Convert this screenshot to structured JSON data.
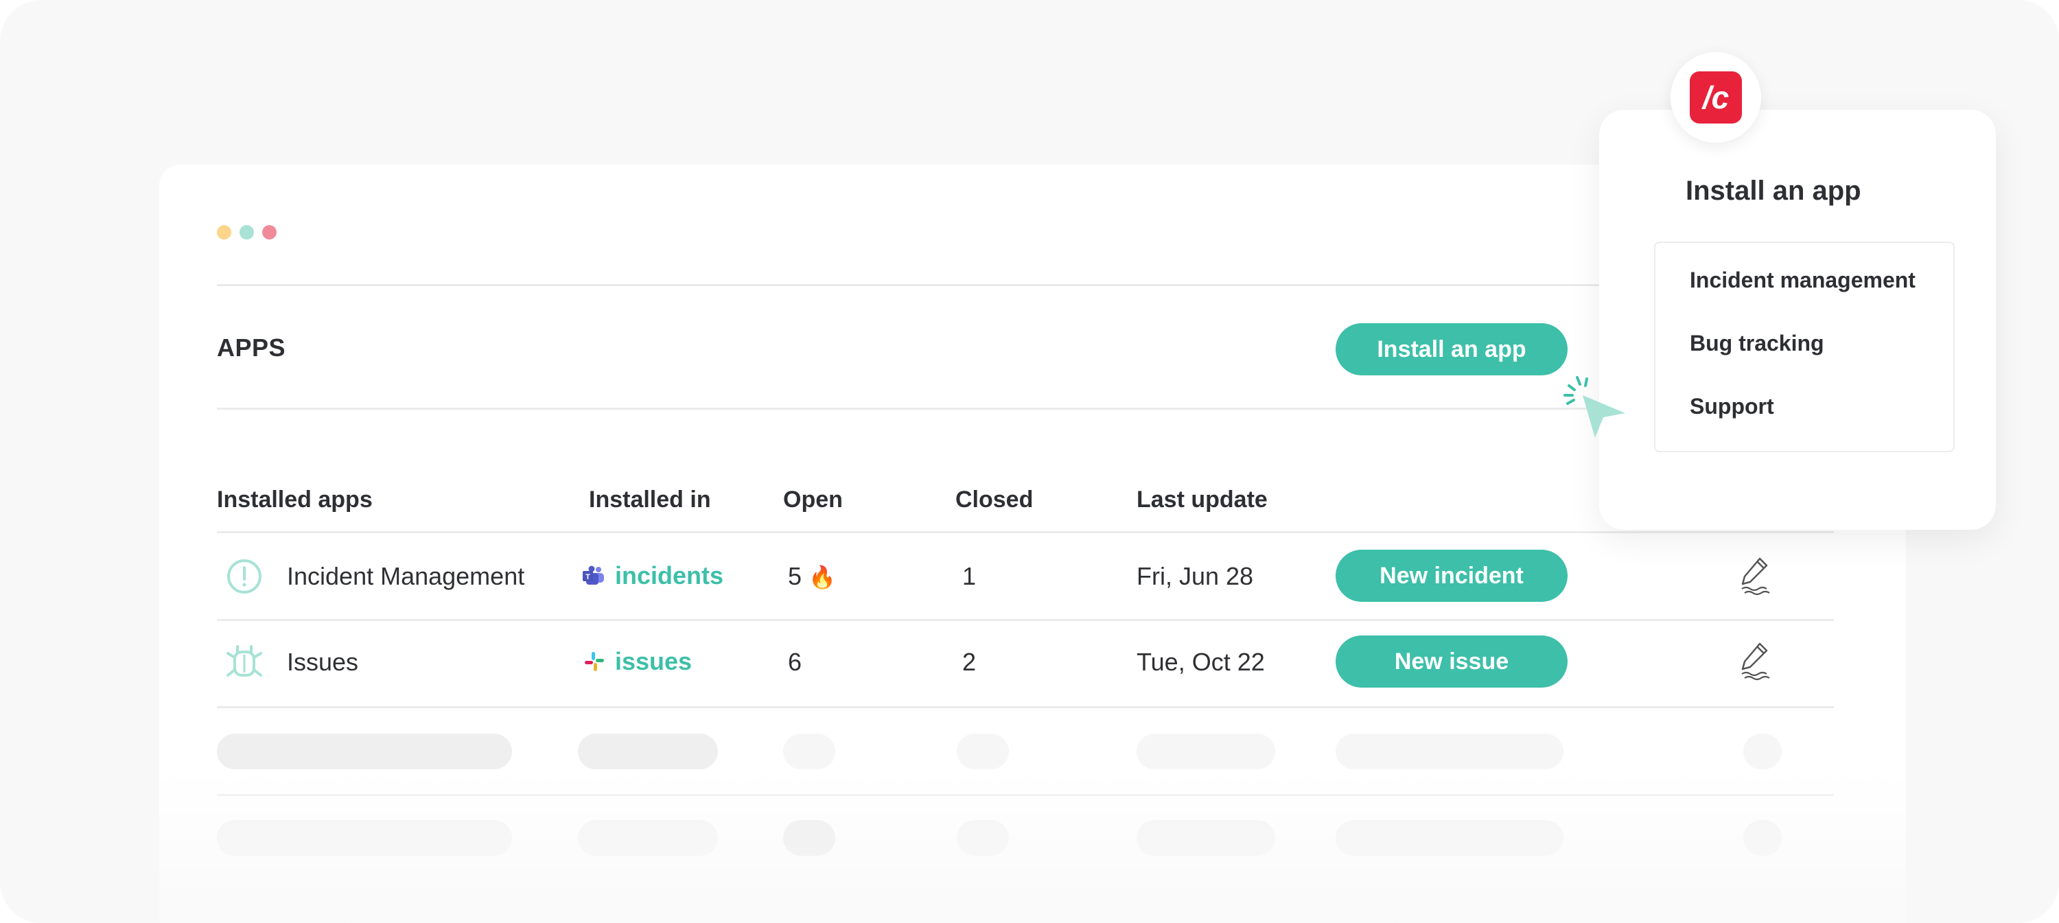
{
  "window": {
    "traffic_lights": [
      "minimize-dot",
      "maximize-dot",
      "close-dot"
    ]
  },
  "apps": {
    "title": "APPS",
    "install_button_label": "Install an app"
  },
  "table": {
    "headers": [
      "Installed apps",
      "Installed in",
      "Open",
      "Closed",
      "Last update"
    ],
    "rows": [
      {
        "icon": "alert-circle-icon",
        "name": "Incident Management",
        "channel_icon": "teams-icon",
        "channel": "incidents",
        "open": "5",
        "open_badge": "🔥",
        "closed": "1",
        "last_update": "Fri, Jun 28",
        "action_label": "New incident",
        "edit_icon": "pencil-icon"
      },
      {
        "icon": "bug-icon",
        "name": "Issues",
        "channel_icon": "slack-icon",
        "channel": "issues",
        "open": "6",
        "open_badge": "",
        "closed": "2",
        "last_update": "Tue, Oct 22",
        "action_label": "New issue",
        "edit_icon": "pencil-icon"
      }
    ]
  },
  "popup": {
    "logo_text": "/c",
    "title": "Install an app",
    "menu": [
      {
        "label": "Incident management"
      },
      {
        "label": "Bug tracking"
      },
      {
        "label": "Support"
      }
    ]
  },
  "colors": {
    "accent": "#3dbfa9",
    "brand": "#e8223a",
    "text": "#2f3033",
    "skeleton": "#efefef"
  }
}
